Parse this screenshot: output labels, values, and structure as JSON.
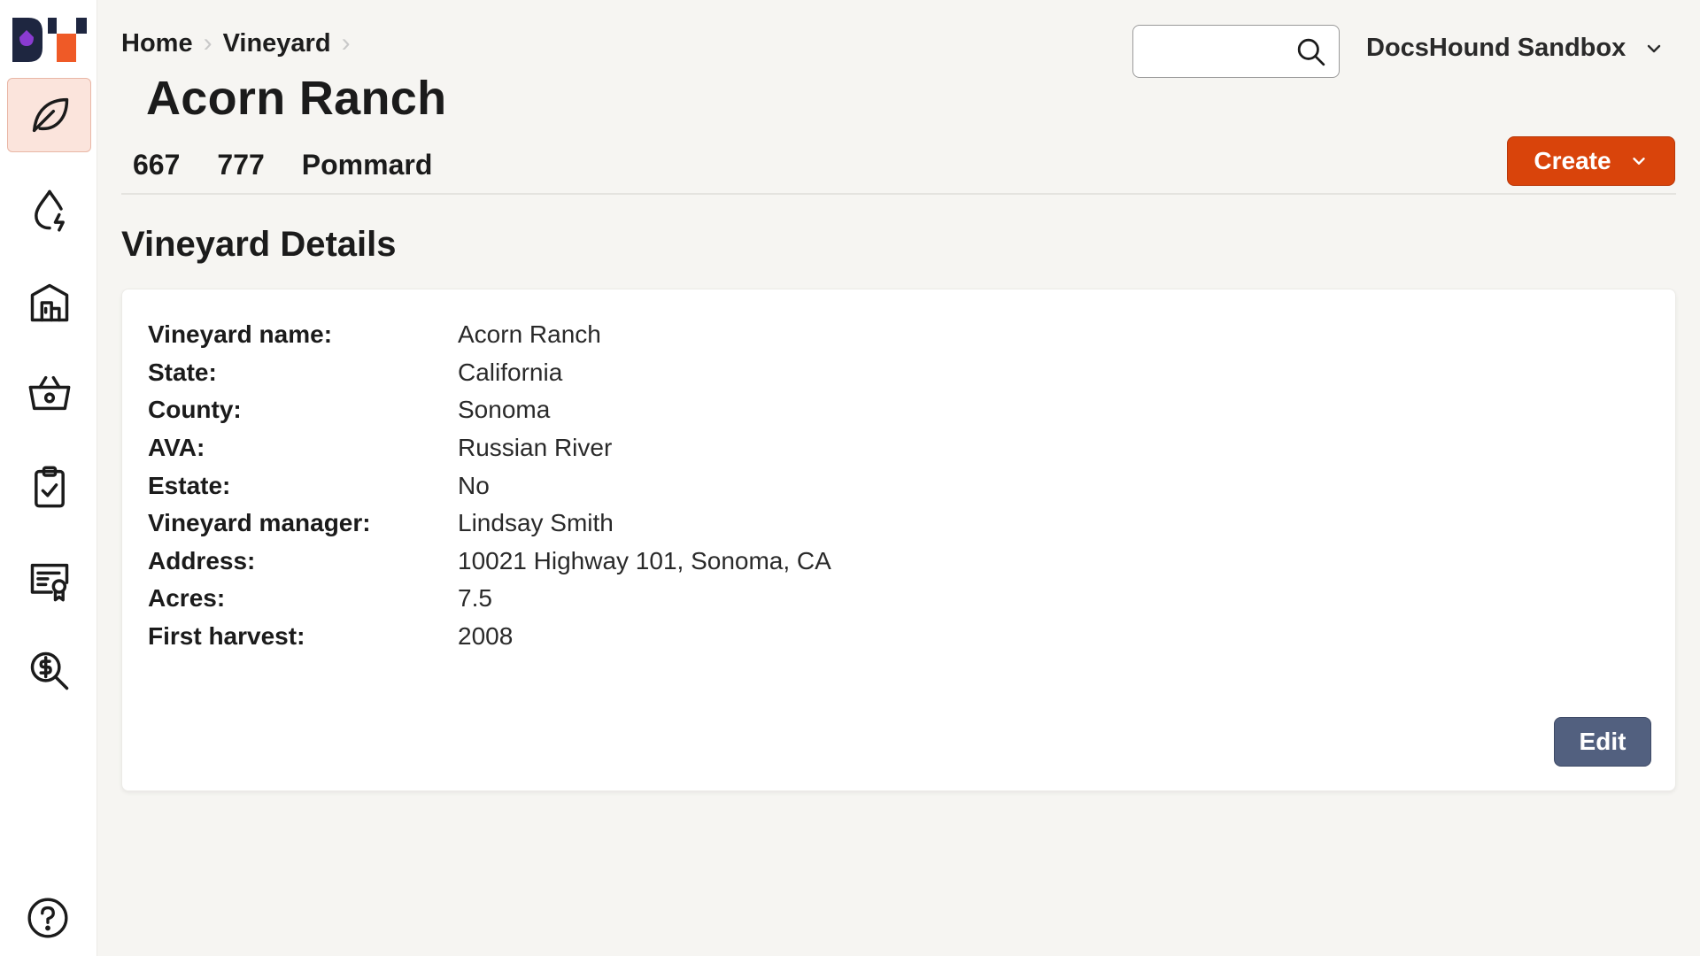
{
  "colors": {
    "accent": "#d9440b",
    "edit_button": "#52607f",
    "active_nav_bg": "#fbe4dc",
    "logo_dark": "#1e2640",
    "logo_orange": "#ef5a27",
    "logo_purple": "#8a3bd1"
  },
  "sidebar": {
    "items": [
      {
        "icon": "leaf-icon",
        "active": true
      },
      {
        "icon": "water-drop-bolt-icon",
        "active": false
      },
      {
        "icon": "building-icon",
        "active": false
      },
      {
        "icon": "basket-icon",
        "active": false
      },
      {
        "icon": "clipboard-check-icon",
        "active": false
      },
      {
        "icon": "certificate-icon",
        "active": false
      },
      {
        "icon": "dollar-search-icon",
        "active": false
      }
    ],
    "help_icon": "help-circle-icon"
  },
  "breadcrumb": {
    "items": [
      "Home",
      "Vineyard"
    ]
  },
  "header": {
    "title": "Acorn Ranch",
    "tags": [
      "667",
      "777",
      "Pommard"
    ],
    "account": "DocsHound Sandbox",
    "search_placeholder": "",
    "create_label": "Create"
  },
  "section": {
    "title": "Vineyard Details"
  },
  "details": [
    {
      "label": "Vineyard name:",
      "value": "Acorn Ranch"
    },
    {
      "label": "State:",
      "value": "California"
    },
    {
      "label": "County:",
      "value": "Sonoma"
    },
    {
      "label": "AVA:",
      "value": "Russian River"
    },
    {
      "label": "Estate:",
      "value": "No"
    },
    {
      "label": "Vineyard manager:",
      "value": "Lindsay Smith"
    },
    {
      "label": "Address:",
      "value": "10021 Highway 101, Sonoma, CA"
    },
    {
      "label": "Acres:",
      "value": "7.5"
    },
    {
      "label": "First harvest:",
      "value": "2008"
    }
  ],
  "actions": {
    "edit_label": "Edit"
  }
}
